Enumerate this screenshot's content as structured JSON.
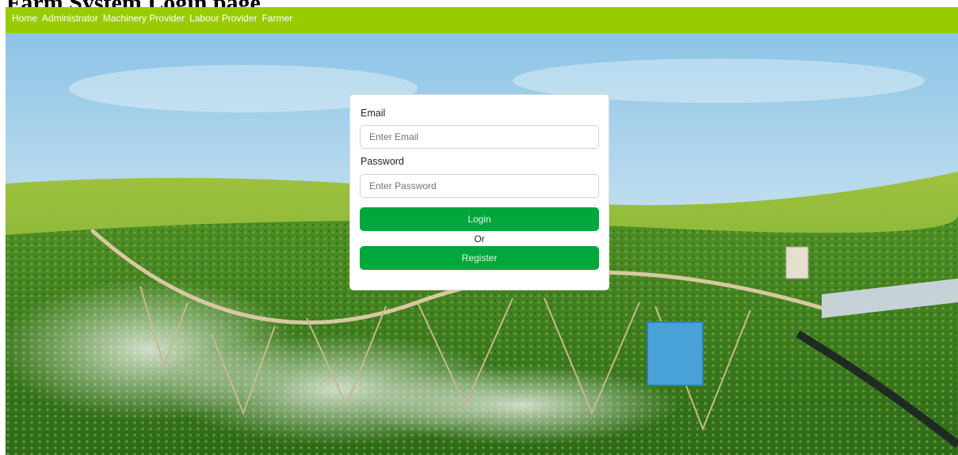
{
  "title": "Farm System Login page",
  "nav": {
    "items": [
      {
        "label": "Home"
      },
      {
        "label": "Administrator"
      },
      {
        "label": "Machinery Provider"
      },
      {
        "label": "Labour Provider"
      },
      {
        "label": "Farmer"
      }
    ]
  },
  "colors": {
    "nav_bg": "#99cc00",
    "button_bg": "#00a83c"
  },
  "form": {
    "email_label": "Email",
    "email_placeholder": "Enter Email",
    "email_value": "",
    "password_label": "Password",
    "password_placeholder": "Enter Password",
    "password_value": "",
    "login_label": "Login",
    "or_label": "Or",
    "register_label": "Register"
  },
  "hero": {
    "icon": "irrigation-field-image"
  }
}
